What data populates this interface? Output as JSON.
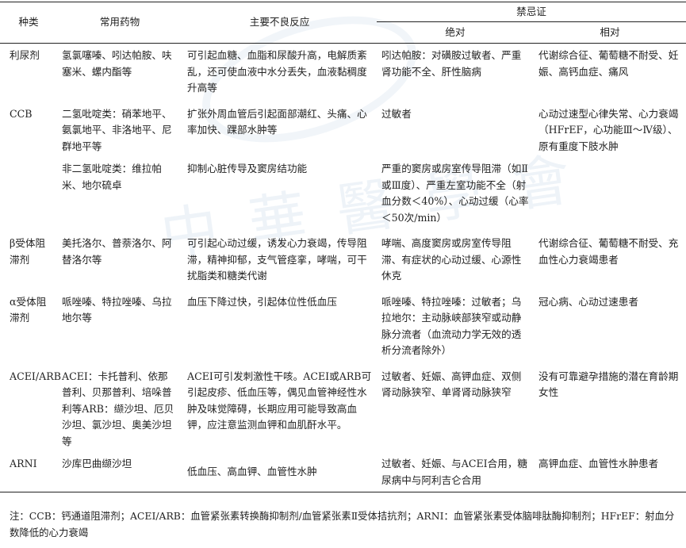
{
  "header": {
    "category": "种类",
    "drugs": "常用药物",
    "adverse": "主要不良反应",
    "contra": "禁忌证",
    "absolute": "绝对",
    "relative": "相对"
  },
  "rows": [
    {
      "category": "利尿剂",
      "drugs": "氢氯噻嗪、吲达帕胺、呋塞米、螺内酯等",
      "adverse": "可引起血糖、血脂和尿酸升高，电解质紊乱，还可使血液中水分丢失，血液黏稠度升高等",
      "absolute": "吲达帕胺：对磺胺过敏者、严重肾功能不全、肝性脑病",
      "relative": "代谢综合征、葡萄糖不耐受、妊娠、高钙血症、痛风"
    },
    {
      "category": "CCB",
      "drugs": "二氢吡啶类：硝苯地平、氨氯地平、非洛地平、尼群地平等",
      "adverse": "扩张外周血管后引起面部潮红、头痛、心率加快、踝部水肿等",
      "absolute": "过敏者",
      "relative": "心动过速型心律失常、心力衰竭（HFrEF，心功能Ⅲ～Ⅳ级）、原有重度下肢水肿"
    },
    {
      "category": "",
      "drugs": "非二氢吡啶类：维拉帕米、地尔硫卓",
      "adverse": "抑制心脏传导及窦房结功能",
      "absolute": "严重的窦房或房室传导阻滞（如Ⅱ或Ⅲ度）、严重左室功能不全（射血分数＜40%）、心动过缓（心率＜50次/min）",
      "relative": ""
    },
    {
      "category": "β受体阻滞剂",
      "drugs": "美托洛尔、普萘洛尔、阿替洛尔等",
      "adverse": "可引起心动过缓，诱发心力衰竭，传导阻滞，精神抑郁，支气管痉挛，哮喘，可干扰脂类和糖类代谢",
      "absolute": "哮喘、高度窦房或房室传导阻滞、有症状的心动过缓、心源性休克",
      "relative": "代谢综合征、葡萄糖不耐受、充血性心力衰竭患者"
    },
    {
      "category": "α受体阻滞剂",
      "drugs": "哌唑嗪、特拉唑嗪、乌拉地尔等",
      "adverse": "血压下降过快，引起体位性低血压",
      "absolute": "哌唑嗪、特拉唑嗪：过敏者；乌拉地尔：主动脉峡部狭窄或动静脉分流者（血流动力学无效的透析分流者除外）",
      "relative": "冠心病、心动过速患者"
    },
    {
      "category": "ACEI/ARB",
      "drugs": "ACEI：卡托普利、依那普利、贝那普利、培哚普利等ARB：缬沙坦、厄贝沙坦、氯沙坦、奥美沙坦等",
      "adverse": "ACEI可引发刺激性干咳。ACEI或ARB可引起皮疹、低血压等，偶见血管神经性水肿及味觉障碍，长期应用可能导致高血钾，应注意监测血钾和血肌酐水平。",
      "absolute": "过敏者、妊娠、高钾血症、双侧肾动脉狭窄、单肾肾动脉狭窄",
      "relative": "没有可靠避孕措施的潜在育龄期女性"
    },
    {
      "category": "ARNI",
      "drugs": "沙库巴曲缬沙坦",
      "adverse": "低血压、高血钾、血管性水肿",
      "absolute": "过敏者、妊娠、与ACEI合用，糖尿病中与阿利吉仑合用",
      "relative": "高钾血症、血管性水肿患者"
    }
  ],
  "note": "注：CCB：钙通道阻滞剂；ACEI/ARB：血管紧张素转换酶抑制剂/血管紧张素Ⅱ受体拮抗剂；ARNI：血管紧张素受体脑啡肽酶抑制剂；HFrEF：射血分数降低的心力衰竭"
}
